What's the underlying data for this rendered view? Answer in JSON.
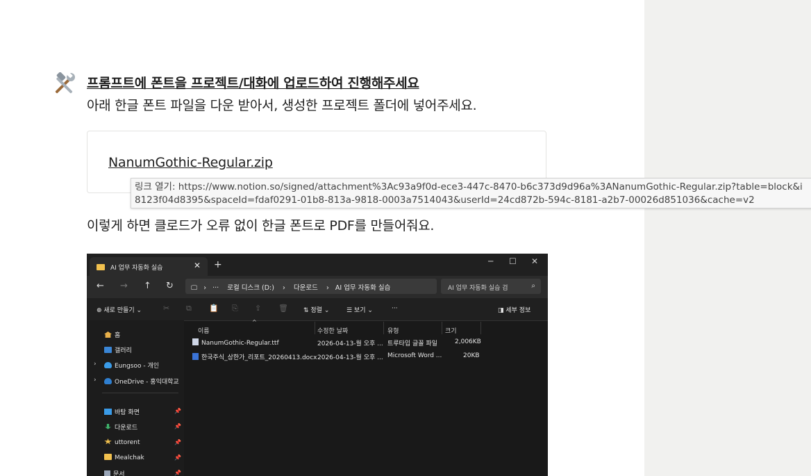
{
  "callout": {
    "icon": "hammer-wrench-icon",
    "heading": "프롬프트에 폰트을 프로젝트/대화에 업로드하여 진행해주세요",
    "description": "아래 한글 폰트 파일을 다운 받아서, 생성한 프로젝트 폴더에 넣어주세요."
  },
  "file_block": {
    "name": "NanumGothic-Regular.zip"
  },
  "tooltip": {
    "line1": "링크 열기: https://www.notion.so/signed/attachment%3Ac93a9f0d-ece3-447c-8470-b6c373d9d96a%3ANanumGothic-Regular.zip?table=block&i",
    "line2": "8123f04d8395&spaceId=fdaf0291-01b8-813a-9818-0003a7514043&userId=24cd872b-594c-8181-a2b7-00026d851036&cache=v2"
  },
  "paragraph2": "이렇게 하면 클로드가 오류 없이 한글 폰트로 PDF를 만들어줘요.",
  "explorer": {
    "tab_title": "AI 업무 자동화 실습",
    "tab_close": "✕",
    "new_tab": "+",
    "window_controls": {
      "minimize": "─",
      "maximize": "☐",
      "close": "✕"
    },
    "nav": {
      "back": "←",
      "forward": "→",
      "up": "↑",
      "refresh": "↻"
    },
    "breadcrumb": {
      "monitor": "🖵",
      "sep": "›",
      "more": "···",
      "drive": "로컬 디스크 (D:)",
      "downloads": "다운로드",
      "folder": "AI 업무 자동화 실습"
    },
    "search_placeholder": "AI 업무 자동화 실습 검",
    "search_icon": "⌕",
    "toolbar": {
      "new": "⊕  새로 만들기 ⌄",
      "cut": "✂",
      "copy": "⧉",
      "paste": "📋",
      "rename": "⎘",
      "share": "⇪",
      "delete": "🗑",
      "sort": "⇅  정렬 ⌄",
      "view": "☰  보기 ⌄",
      "more": "···",
      "details": "◨  세부 정보"
    },
    "sidebar": [
      {
        "label": "홈",
        "icon": "home-icon",
        "color": "#e8b04a"
      },
      {
        "label": "갤러리",
        "icon": "gallery-icon",
        "color": "#3a86d6"
      },
      {
        "label": "Eungsoo - 개인",
        "icon": "cloud-icon",
        "color": "#3a9be8"
      },
      {
        "label": "OneDrive - 홍익대학교",
        "icon": "cloud-icon",
        "color": "#2f7fd0"
      },
      {
        "label": "바탕 화면",
        "icon": "desktop-icon",
        "color": "#3a9be8"
      },
      {
        "label": "다운로드",
        "icon": "download-icon",
        "color": "#3fb36b"
      },
      {
        "label": "uttorent",
        "icon": "star-icon",
        "color": "#f2c14e"
      },
      {
        "label": "Mealchak",
        "icon": "folder-icon",
        "color": "#f2c14e"
      },
      {
        "label": "문서",
        "icon": "document-icon",
        "color": "#9aa6b8"
      }
    ],
    "sidebar_arrow": "›",
    "pin": "📌",
    "columns": {
      "name": "이름",
      "modified": "수정한 날짜",
      "type": "유형",
      "size": "크기"
    },
    "sort_caret": "^",
    "files": [
      {
        "name": "NanumGothic-Regular.ttf",
        "modified": "2026-04-13-월 오후 ...",
        "type": "트루타입 글꼴 파일",
        "size": "2,006KB",
        "icon_color": "#cfd6e6"
      },
      {
        "name": "한국주식_상한가_리포트_20260413.docx",
        "modified": "2026-04-13-월 오후 ...",
        "type": "Microsoft Word ...",
        "size": "20KB",
        "icon_color": "#3b74d8"
      }
    ]
  }
}
